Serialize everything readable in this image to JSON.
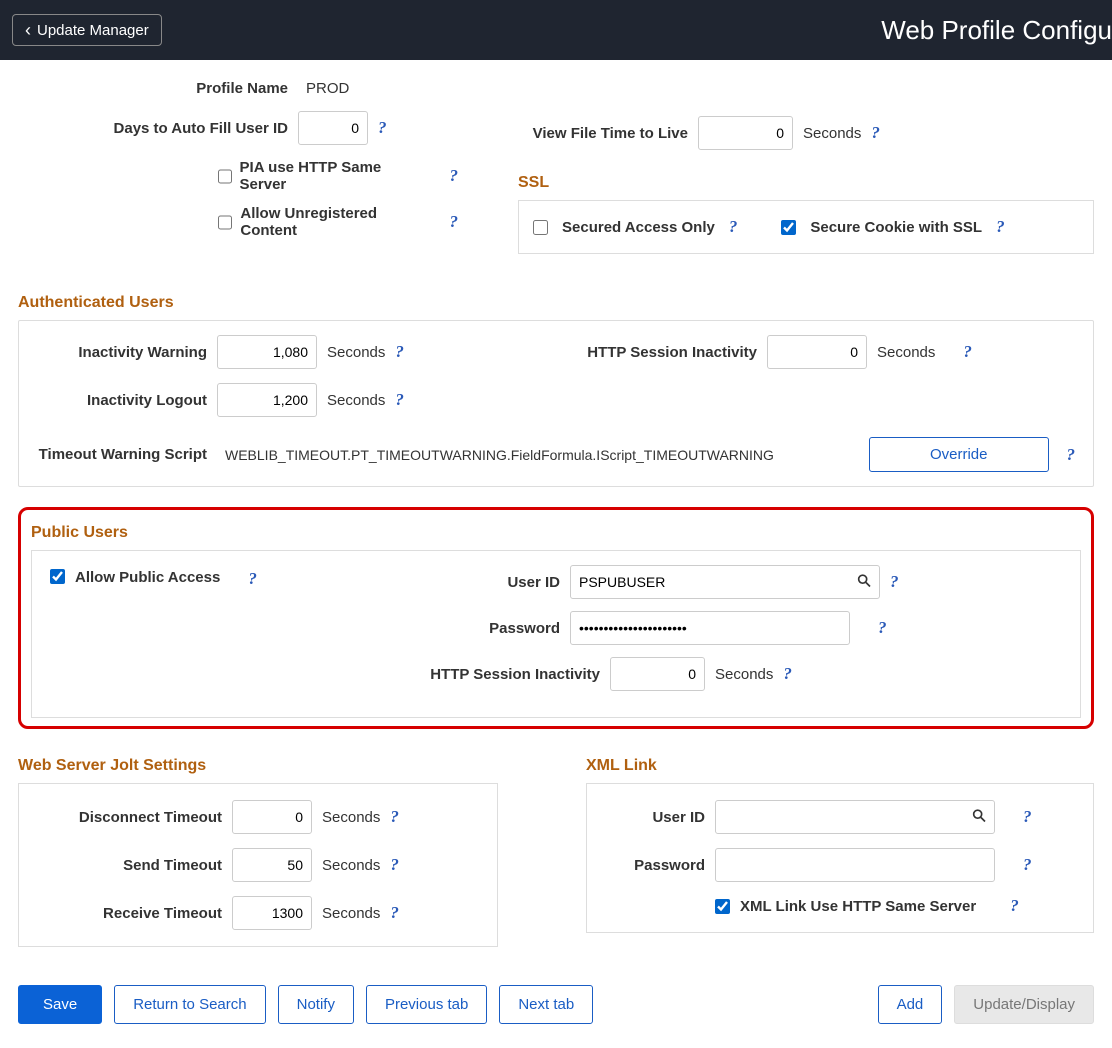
{
  "header": {
    "back_label": "Update Manager",
    "title": "Web Profile Configu"
  },
  "profile": {
    "name_label": "Profile Name",
    "name_value": "PROD",
    "days_label": "Days to Auto Fill User ID",
    "days_value": "0",
    "pia_label": "PIA use HTTP Same Server",
    "unreg_label": "Allow Unregistered Content",
    "viewfile_label": "View File Time to Live",
    "viewfile_value": "0",
    "seconds": "Seconds"
  },
  "ssl": {
    "title": "SSL",
    "secured_label": "Secured Access Only",
    "secure_cookie_label": "Secure Cookie with SSL"
  },
  "auth": {
    "title": "Authenticated Users",
    "warn_label": "Inactivity Warning",
    "warn_value": "1,080",
    "logout_label": "Inactivity Logout",
    "logout_value": "1,200",
    "http_label": "HTTP Session Inactivity",
    "http_value": "0",
    "timeout_label": "Timeout Warning Script",
    "timeout_value": "WEBLIB_TIMEOUT.PT_TIMEOUTWARNING.FieldFormula.IScript_TIMEOUTWARNING",
    "override_label": "Override",
    "seconds": "Seconds"
  },
  "public": {
    "title": "Public Users",
    "allow_label": "Allow Public Access",
    "user_label": "User ID",
    "user_value": "PSPUBUSER",
    "pwd_label": "Password",
    "pwd_value": "••••••••••••••••••••••",
    "http_label": "HTTP Session Inactivity",
    "http_value": "0",
    "seconds": "Seconds"
  },
  "jolt": {
    "title": "Web Server Jolt Settings",
    "disc_label": "Disconnect Timeout",
    "disc_value": "0",
    "send_label": "Send Timeout",
    "send_value": "50",
    "recv_label": "Receive Timeout",
    "recv_value": "1300",
    "seconds": "Seconds"
  },
  "xml": {
    "title": "XML Link",
    "user_label": "User ID",
    "user_value": "",
    "pwd_label": "Password",
    "pwd_value": "",
    "same_label": "XML Link Use HTTP Same Server"
  },
  "buttons": {
    "save": "Save",
    "return": "Return to Search",
    "notify": "Notify",
    "prev": "Previous tab",
    "next": "Next tab",
    "add": "Add",
    "update": "Update/Display"
  }
}
